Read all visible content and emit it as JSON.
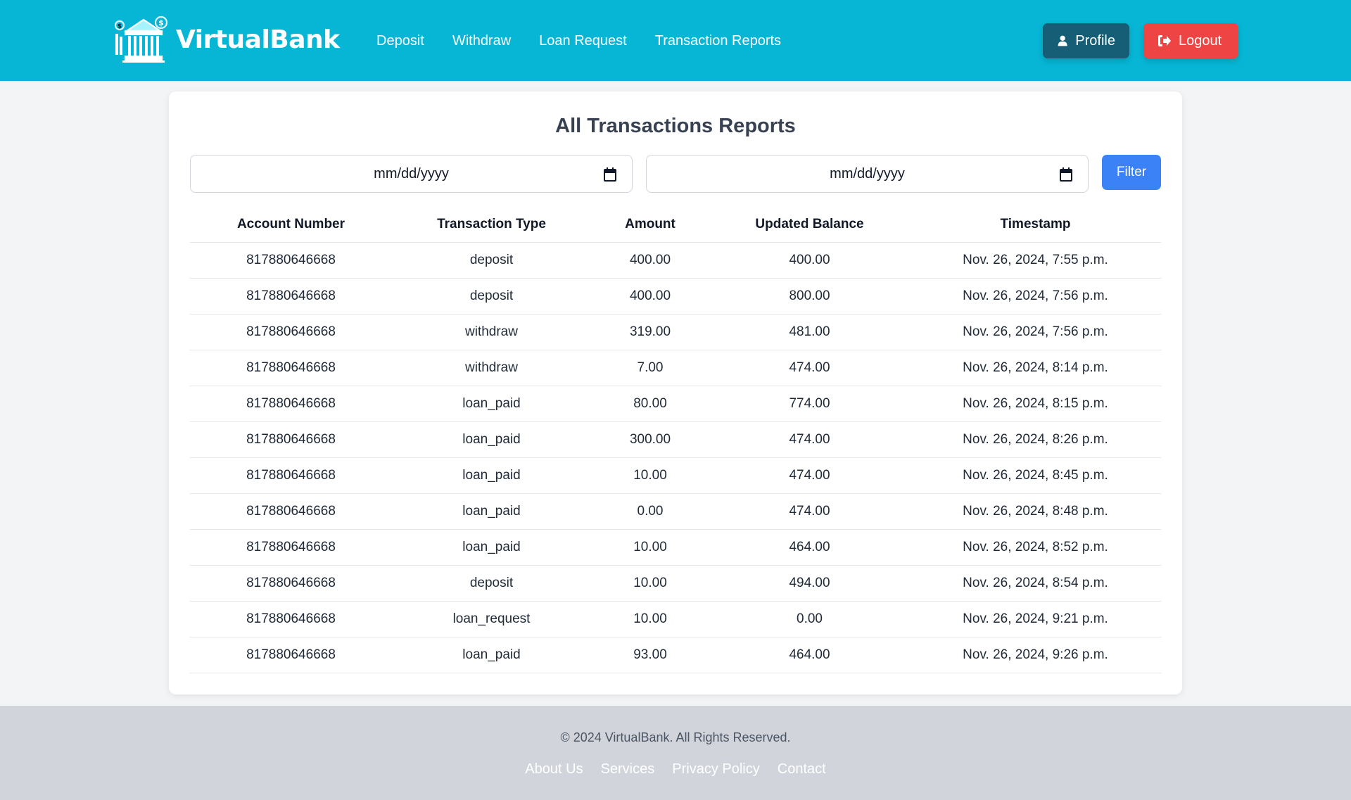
{
  "brand": {
    "name": "VirtualBank"
  },
  "nav": {
    "items": [
      {
        "label": "Deposit"
      },
      {
        "label": "Withdraw"
      },
      {
        "label": "Loan Request"
      },
      {
        "label": "Transaction Reports"
      }
    ]
  },
  "header": {
    "profile_label": "Profile",
    "logout_label": "Logout"
  },
  "colors": {
    "header_bg": "#06b6d4",
    "profile_btn": "#155e75",
    "logout_btn": "#ef4444",
    "filter_btn": "#3b82f6",
    "footer_bg": "#d1d5db"
  },
  "main": {
    "title": "All Transactions Reports",
    "start_date_placeholder": "mm/dd/yyyy",
    "end_date_placeholder": "mm/dd/yyyy",
    "filter_label": "Filter",
    "table": {
      "headers": [
        "Account Number",
        "Transaction Type",
        "Amount",
        "Updated Balance",
        "Timestamp"
      ],
      "rows": [
        [
          "817880646668",
          "deposit",
          "400.00",
          "400.00",
          "Nov. 26, 2024, 7:55 p.m."
        ],
        [
          "817880646668",
          "deposit",
          "400.00",
          "800.00",
          "Nov. 26, 2024, 7:56 p.m."
        ],
        [
          "817880646668",
          "withdraw",
          "319.00",
          "481.00",
          "Nov. 26, 2024, 7:56 p.m."
        ],
        [
          "817880646668",
          "withdraw",
          "7.00",
          "474.00",
          "Nov. 26, 2024, 8:14 p.m."
        ],
        [
          "817880646668",
          "loan_paid",
          "80.00",
          "774.00",
          "Nov. 26, 2024, 8:15 p.m."
        ],
        [
          "817880646668",
          "loan_paid",
          "300.00",
          "474.00",
          "Nov. 26, 2024, 8:26 p.m."
        ],
        [
          "817880646668",
          "loan_paid",
          "10.00",
          "474.00",
          "Nov. 26, 2024, 8:45 p.m."
        ],
        [
          "817880646668",
          "loan_paid",
          "0.00",
          "474.00",
          "Nov. 26, 2024, 8:48 p.m."
        ],
        [
          "817880646668",
          "loan_paid",
          "10.00",
          "464.00",
          "Nov. 26, 2024, 8:52 p.m."
        ],
        [
          "817880646668",
          "deposit",
          "10.00",
          "494.00",
          "Nov. 26, 2024, 8:54 p.m."
        ],
        [
          "817880646668",
          "loan_request",
          "10.00",
          "0.00",
          "Nov. 26, 2024, 9:21 p.m."
        ],
        [
          "817880646668",
          "loan_paid",
          "93.00",
          "464.00",
          "Nov. 26, 2024, 9:26 p.m."
        ]
      ]
    }
  },
  "footer": {
    "copyright": "© 2024 VirtualBank. All Rights Reserved.",
    "links": [
      {
        "label": "About Us"
      },
      {
        "label": "Services"
      },
      {
        "label": "Privacy Policy"
      },
      {
        "label": "Contact"
      }
    ]
  }
}
